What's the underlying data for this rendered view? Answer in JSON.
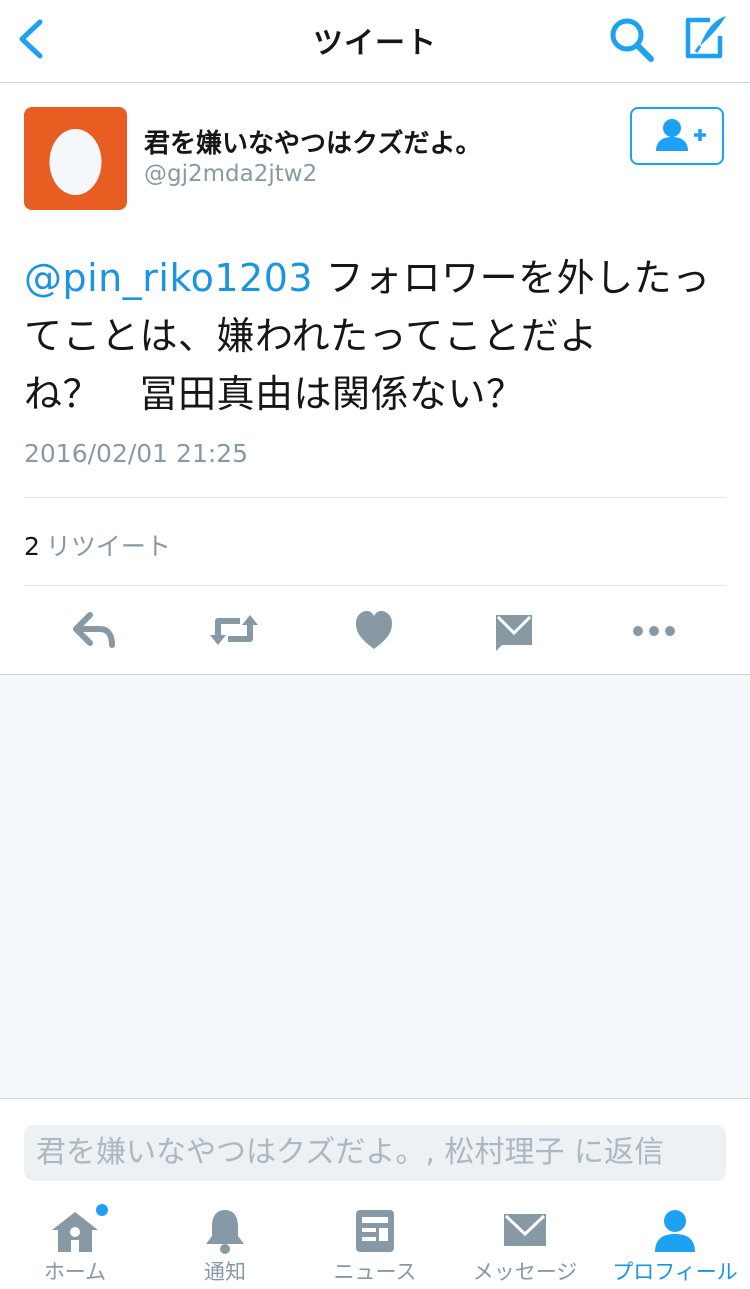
{
  "header": {
    "title": "ツイート",
    "back_icon": "chevron-left-icon",
    "search_icon": "search-icon",
    "compose_icon": "compose-icon"
  },
  "tweet": {
    "display_name": "君を嫌いなやつはクズだよ。",
    "handle": "@gj2mda2jtw2",
    "mention": "@pin_riko1203",
    "text_line1_rest": " フォロワーを外したっ",
    "text_line2": "てことは、嫌われたってことだよ",
    "text_line3": "ね？　冨田真由は関係ない？",
    "timestamp": "2016/02/01 21:25",
    "retweet_count": "2",
    "retweet_label": "リツイート"
  },
  "reply": {
    "placeholder": "君を嫌いなやつはクズだよ。, 松村理子 に返信"
  },
  "tabs": [
    {
      "label": "ホーム",
      "icon": "home-icon"
    },
    {
      "label": "通知",
      "icon": "bell-icon"
    },
    {
      "label": "ニュース",
      "icon": "news-icon"
    },
    {
      "label": "メッセージ",
      "icon": "envelope-icon"
    },
    {
      "label": "プロフィール",
      "icon": "person-icon"
    }
  ],
  "colors": {
    "accent": "#1da1f2",
    "link": "#1b95e0",
    "muted": "#8899a6",
    "avatar_bg": "#e85d22"
  }
}
